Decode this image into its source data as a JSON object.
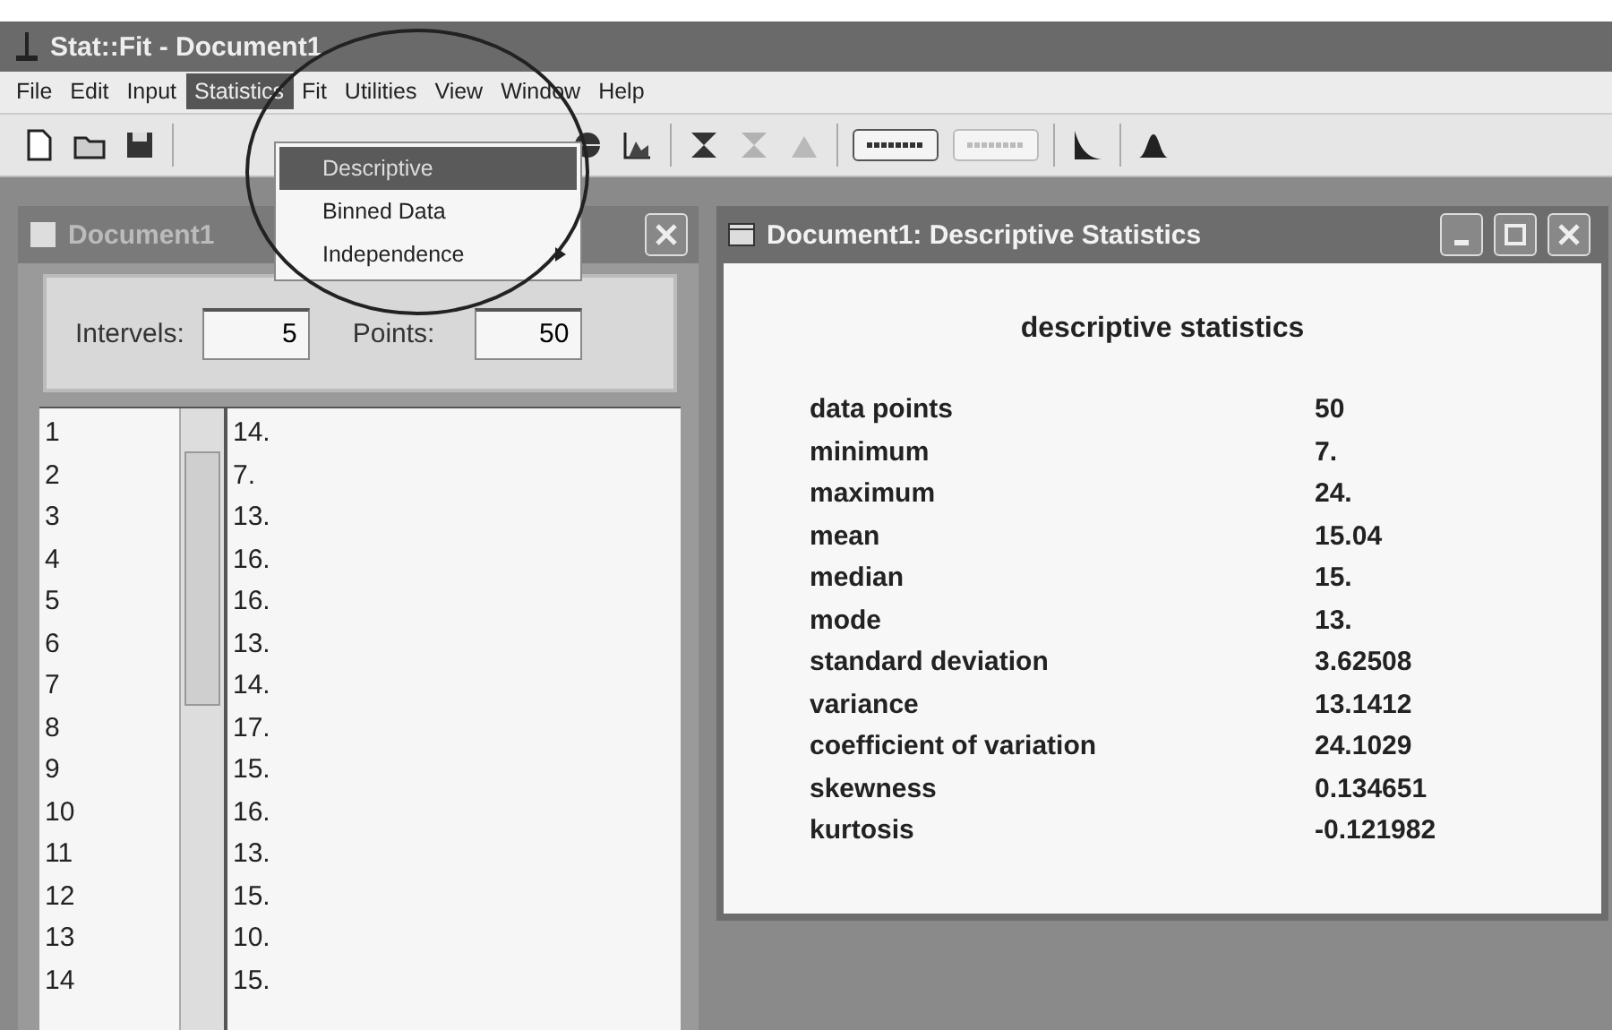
{
  "window": {
    "title": "Stat::Fit - Document1"
  },
  "menu": [
    {
      "label": "File",
      "selected": false
    },
    {
      "label": "Edit",
      "selected": false
    },
    {
      "label": "Input",
      "selected": false
    },
    {
      "label": "Statistics",
      "selected": true
    },
    {
      "label": "Fit",
      "selected": false
    },
    {
      "label": "Utilities",
      "selected": false
    },
    {
      "label": "View",
      "selected": false
    },
    {
      "label": "Window",
      "selected": false
    },
    {
      "label": "Help",
      "selected": false
    }
  ],
  "dropdown": [
    {
      "label": "Descriptive",
      "selected": true,
      "submenu": false
    },
    {
      "label": "Binned Data",
      "selected": false,
      "submenu": false
    },
    {
      "label": "Independence",
      "selected": false,
      "submenu": true
    }
  ],
  "data_window": {
    "title": "Document1",
    "intervals_label": "Intervels:",
    "intervals": "5",
    "points_label": "Points:",
    "points": "50",
    "rows": [
      {
        "index": "1",
        "value": "14."
      },
      {
        "index": "2",
        "value": "7."
      },
      {
        "index": "3",
        "value": "13."
      },
      {
        "index": "4",
        "value": "16."
      },
      {
        "index": "5",
        "value": "16."
      },
      {
        "index": "6",
        "value": "13."
      },
      {
        "index": "7",
        "value": "14."
      },
      {
        "index": "8",
        "value": "17."
      },
      {
        "index": "9",
        "value": "15."
      },
      {
        "index": "10",
        "value": "16."
      },
      {
        "index": "11",
        "value": "13."
      },
      {
        "index": "12",
        "value": "15."
      },
      {
        "index": "13",
        "value": "10."
      },
      {
        "index": "14",
        "value": "15."
      }
    ]
  },
  "stats_window": {
    "title": "Document1: Descriptive Statistics",
    "heading": "descriptive statistics",
    "rows": [
      {
        "label": "data points",
        "value": "50"
      },
      {
        "label": "minimum",
        "value": "7."
      },
      {
        "label": "maximum",
        "value": "24."
      },
      {
        "label": "mean",
        "value": "15.04"
      },
      {
        "label": "median",
        "value": "15."
      },
      {
        "label": "mode",
        "value": "13."
      },
      {
        "label": "standard deviation",
        "value": "3.62508"
      },
      {
        "label": "variance",
        "value": "13.1412"
      },
      {
        "label": "coefficient of variation",
        "value": "24.1029"
      },
      {
        "label": "skewness",
        "value": "0.134651"
      },
      {
        "label": "kurtosis",
        "value": "-0.121982"
      }
    ]
  }
}
